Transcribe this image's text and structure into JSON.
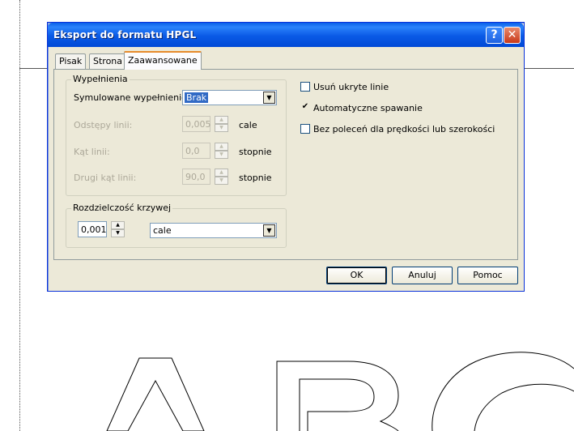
{
  "dialog": {
    "title": "Eksport do formatu HPGL",
    "help_button": "?",
    "close_button": "✕"
  },
  "tabs": [
    {
      "label": "Pisak"
    },
    {
      "label": "Strona"
    },
    {
      "label": "Zaawansowane"
    }
  ],
  "fill_group": {
    "label": "Wypełnienia",
    "simulated_fill": {
      "label": "Symulowane wypełnienie:",
      "value": "Brak"
    },
    "line_spacing": {
      "label": "Odstępy linii:",
      "value": "0,005",
      "unit": "cale"
    },
    "line_angle": {
      "label": "Kąt linii:",
      "value": "0,0",
      "unit": "stopnie"
    },
    "second_angle": {
      "label": "Drugi kąt linii:",
      "value": "90,0",
      "unit": "stopnie"
    }
  },
  "curve_group": {
    "label": "Rozdzielczość krzywej",
    "value": "0,001",
    "unit": "cale"
  },
  "options": [
    {
      "label": "Usuń ukryte linie",
      "checked": false
    },
    {
      "label": "Automatyczne spawanie",
      "checked": true
    },
    {
      "label": "Bez poleceń dla prędkości lub szerokości",
      "checked": false
    }
  ],
  "buttons": {
    "ok": "OK",
    "cancel": "Anuluj",
    "help": "Pomoc"
  },
  "colors": {
    "titlebar": "#0a5ae6",
    "dialog_bg": "#ece9d8",
    "selection": "#316ac5"
  },
  "icons": {
    "check": "✔",
    "arrow_down": "▼",
    "arrow_up": "▲"
  }
}
